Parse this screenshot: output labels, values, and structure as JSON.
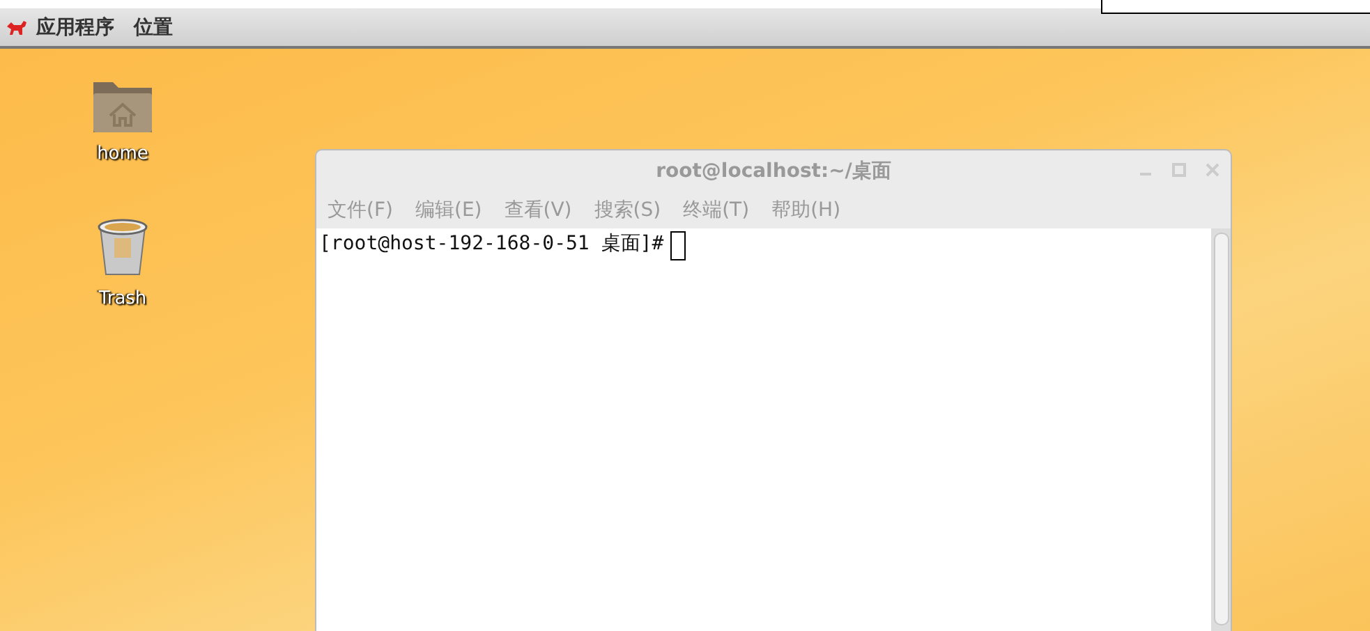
{
  "panel": {
    "menus": [
      "应用程序",
      "位置"
    ]
  },
  "desktop_icons": [
    {
      "kind": "folder",
      "label": "home"
    },
    {
      "kind": "trash",
      "label": "Trash"
    }
  ],
  "terminal": {
    "title": "root@localhost:~/桌面",
    "menu": [
      "文件(F)",
      "编辑(E)",
      "查看(V)",
      "搜索(S)",
      "终端(T)",
      "帮助(H)"
    ],
    "prompt": "[root@host-192-168-0-51 桌面]#"
  }
}
